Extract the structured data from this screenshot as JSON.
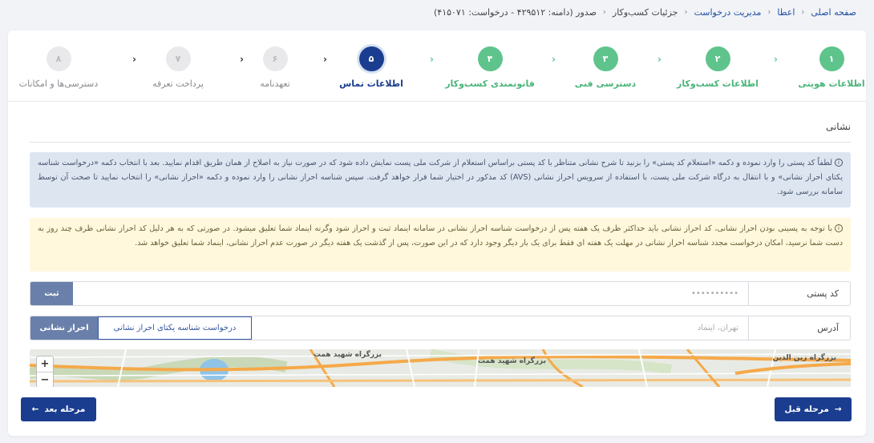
{
  "breadcrumb": {
    "items": [
      "صفحه اصلی",
      "اعطا",
      "مدیریت درخواست",
      "جزئیات کسب‌وکار",
      "صدور (دامنه: ۴۲۹۵۱۲ - درخواست: ۴۱۵۰۷۱)"
    ]
  },
  "steps": [
    {
      "num": "۱",
      "label": "اطلاعات هویتی",
      "state": "done"
    },
    {
      "num": "۲",
      "label": "اطلاعات کسب‌وکار",
      "state": "done"
    },
    {
      "num": "۳",
      "label": "دسترسی فنی",
      "state": "done"
    },
    {
      "num": "۴",
      "label": "قانونمندی کسب‌وکار",
      "state": "done"
    },
    {
      "num": "۵",
      "label": "اطلاعات تماس",
      "state": "active"
    },
    {
      "num": "۶",
      "label": "تعهدنامه",
      "state": "pending"
    },
    {
      "num": "۷",
      "label": "پرداخت تعرفه",
      "state": "pending"
    },
    {
      "num": "۸",
      "label": "دسترسی‌ها و امکانات",
      "state": "pending"
    }
  ],
  "section": {
    "title": "نشانی"
  },
  "alerts": {
    "info": "لطفاً کد پستی را وارد نموده و دکمه «استعلام کد پستی» را بزنید تا شرح نشانی متناظر با کد پستی براساس استعلام از شرکت ملی پست نمایش داده شود که در صورت نیاز به اصلاح از همان طریق اقدام نمایید. بعد با انتخاب دکمه «درخواست شناسه یکتای احراز نشانی» و با انتقال به درگاه شرکت ملی پست، با استفاده از سرویس احراز نشانی (AVS) کد مذکور در اختیار شما قرار خواهد گرفت. سپس شناسه احراز نشانی را وارد نموده و دکمه «احراز نشانی» را انتخاب نمایید تا صحت آن توسط سامانه بررسی شود.",
    "warning": "با توجه به پسینی بودن احراز نشانی، کد احراز نشانی باید حداکثر ظرف یک هفته پس از درخواست شناسه احراز نشانی در سامانه اینماد ثبت و احراز شود وگرنه اینماد شما تعلیق میشود. در صورتی که به هر دلیل کد احراز نشانی ظرف چند روز به دست شما نرسید، امکان درخواست مجدد شناسه احراز نشانی در مهلت یک هفته ای فقط برای یک بار دیگر وجود دارد که در این صورت، پس از گذشت یک هفته دیگر در صورت عدم احراز نشانی، اینماد شما تعلیق خواهد شد."
  },
  "postal": {
    "label": "کد پستی",
    "placeholder": "••••••••••",
    "submit": "ثبت"
  },
  "address": {
    "label": "آدرس",
    "placeholder": "تهران، اینماد",
    "request_button": "درخواست شناسه یکتای احراز نشانی",
    "verify_button": "احراز نشانی"
  },
  "map": {
    "labels": [
      "بزرگراه شهید همت",
      "بزرگراه شهید همت",
      "بزرگراه زین الدین"
    ],
    "zoom_in": "+",
    "zoom_out": "−"
  },
  "nav": {
    "prev": "مرحله قبل",
    "next": "مرحله بعد",
    "prev_arrow": "→",
    "next_arrow": "←"
  },
  "colors": {
    "primary": "#1a3d8f",
    "success": "#5ec48b",
    "info_bg": "#dde5f1",
    "warning_bg": "#fff8dd"
  }
}
